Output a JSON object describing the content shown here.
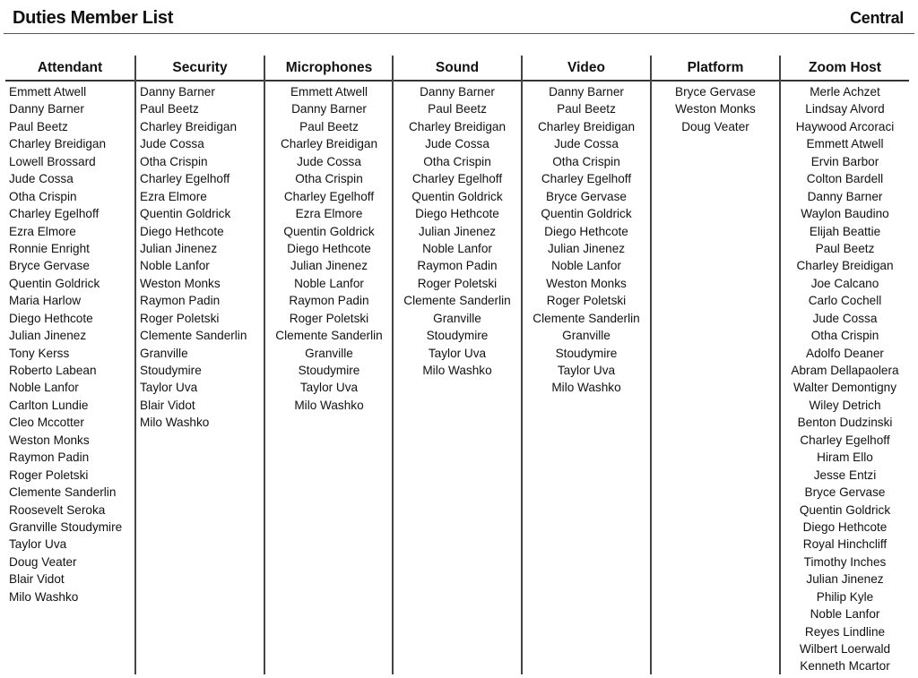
{
  "header": {
    "title": "Duties Member List",
    "region": "Central"
  },
  "columns": [
    {
      "heading": "Attendant",
      "align": "left",
      "names": [
        "Emmett Atwell",
        "Danny Barner",
        "Paul Beetz",
        "Charley Breidigan",
        "Lowell Brossard",
        "Jude Cossa",
        "Otha Crispin",
        "Charley Egelhoff",
        "Ezra Elmore",
        "Ronnie Enright",
        "Bryce Gervase",
        "Quentin Goldrick",
        "Maria Harlow",
        "Diego Hethcote",
        "Julian Jinenez",
        "Tony Kerss",
        "Roberto Labean",
        "Noble Lanfor",
        "Carlton Lundie",
        "Cleo Mccotter",
        "Weston Monks",
        "Raymon Padin",
        "Roger Poletski",
        "Clemente Sanderlin",
        "Roosevelt Seroka",
        "Granville Stoudymire",
        "Taylor Uva",
        "Doug Veater",
        "Blair Vidot",
        "Milo Washko"
      ]
    },
    {
      "heading": "Security",
      "align": "left",
      "names": [
        "Danny Barner",
        "Paul Beetz",
        "Charley Breidigan",
        "Jude Cossa",
        "Otha Crispin",
        "Charley Egelhoff",
        "Ezra Elmore",
        "Quentin Goldrick",
        "Diego Hethcote",
        "Julian Jinenez",
        "Noble Lanfor",
        "Weston Monks",
        "Raymon Padin",
        "Roger Poletski",
        "Clemente Sanderlin",
        "Granville",
        "Stoudymire",
        "Taylor Uva",
        "Blair Vidot",
        "Milo Washko"
      ]
    },
    {
      "heading": "Microphones",
      "align": "center",
      "names": [
        "Emmett Atwell",
        "Danny Barner",
        "Paul Beetz",
        "Charley Breidigan",
        "Jude Cossa",
        "Otha Crispin",
        "Charley Egelhoff",
        "Ezra Elmore",
        "Quentin Goldrick",
        "Diego Hethcote",
        "Julian Jinenez",
        "Noble Lanfor",
        "Raymon Padin",
        "Roger Poletski",
        "Clemente Sanderlin",
        "Granville",
        "Stoudymire",
        "Taylor Uva",
        "Milo Washko"
      ]
    },
    {
      "heading": "Sound",
      "align": "center",
      "names": [
        "Danny Barner",
        "Paul Beetz",
        "Charley Breidigan",
        "Jude Cossa",
        "Otha Crispin",
        "Charley Egelhoff",
        "Quentin Goldrick",
        "Diego Hethcote",
        "Julian Jinenez",
        "Noble Lanfor",
        "Raymon Padin",
        "Roger Poletski",
        "Clemente Sanderlin",
        "Granville",
        "Stoudymire",
        "Taylor Uva",
        "Milo Washko"
      ]
    },
    {
      "heading": "Video",
      "align": "center",
      "names": [
        "Danny Barner",
        "Paul Beetz",
        "Charley Breidigan",
        "Jude Cossa",
        "Otha Crispin",
        "Charley Egelhoff",
        "Bryce Gervase",
        "Quentin Goldrick",
        "Diego Hethcote",
        "Julian Jinenez",
        "Noble Lanfor",
        "Weston Monks",
        "Roger Poletski",
        "Clemente Sanderlin",
        "Granville",
        "Stoudymire",
        "Taylor Uva",
        "Milo Washko"
      ]
    },
    {
      "heading": "Platform",
      "align": "center",
      "names": [
        "Bryce Gervase",
        "Weston Monks",
        "Doug Veater"
      ]
    },
    {
      "heading": "Zoom Host",
      "align": "center",
      "names": [
        "Merle Achzet",
        "Lindsay Alvord",
        "Haywood Arcoraci",
        "Emmett Atwell",
        "Ervin Barbor",
        "Colton Bardell",
        "Danny Barner",
        "Waylon Baudino",
        "Elijah Beattie",
        "Paul Beetz",
        "Charley Breidigan",
        "Joe Calcano",
        "Carlo Cochell",
        "Jude Cossa",
        "Otha Crispin",
        "Adolfo Deaner",
        "Abram Dellapaolera",
        "Walter Demontigny",
        "Wiley Detrich",
        "Benton Dudzinski",
        "Charley Egelhoff",
        "Hiram Ello",
        "Jesse Entzi",
        "Bryce Gervase",
        "Quentin Goldrick",
        "Diego Hethcote",
        "Royal Hinchcliff",
        "Timothy Inches",
        "Julian Jinenez",
        "Philip Kyle",
        "Noble Lanfor",
        "Reyes Lindline",
        "Wilbert Loerwald",
        "Kenneth Mcartor"
      ]
    }
  ]
}
